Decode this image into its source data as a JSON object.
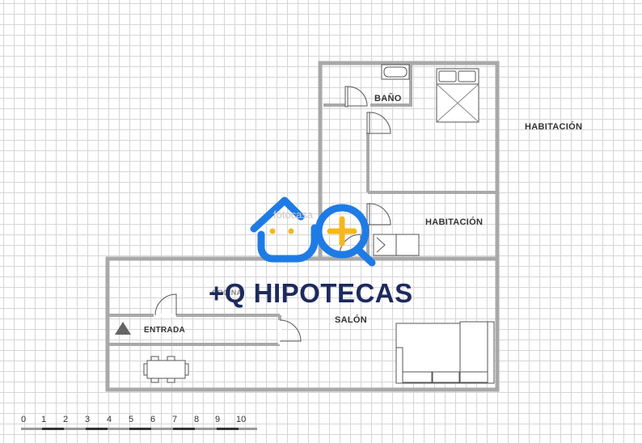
{
  "rooms": {
    "bano": "BAÑO",
    "habitacion_1": "HABITACIÓN",
    "habitacion_2": "HABITACIÓN",
    "cocina": "COCINA",
    "entrada": "ENTRADA",
    "salon": "SALÓN"
  },
  "scale_bar": {
    "ticks": [
      "0",
      "1",
      "2",
      "3",
      "4",
      "5",
      "6",
      "7",
      "8",
      "9",
      "10"
    ]
  },
  "watermark": {
    "brand": "+Q HIPOTECAS",
    "background_text": "fotocasa"
  },
  "colors": {
    "wall": "#a9a9a9",
    "logo_blue": "#1e7be6",
    "logo_yellow": "#f5b71d",
    "brand_navy": "#1d2a5c"
  }
}
